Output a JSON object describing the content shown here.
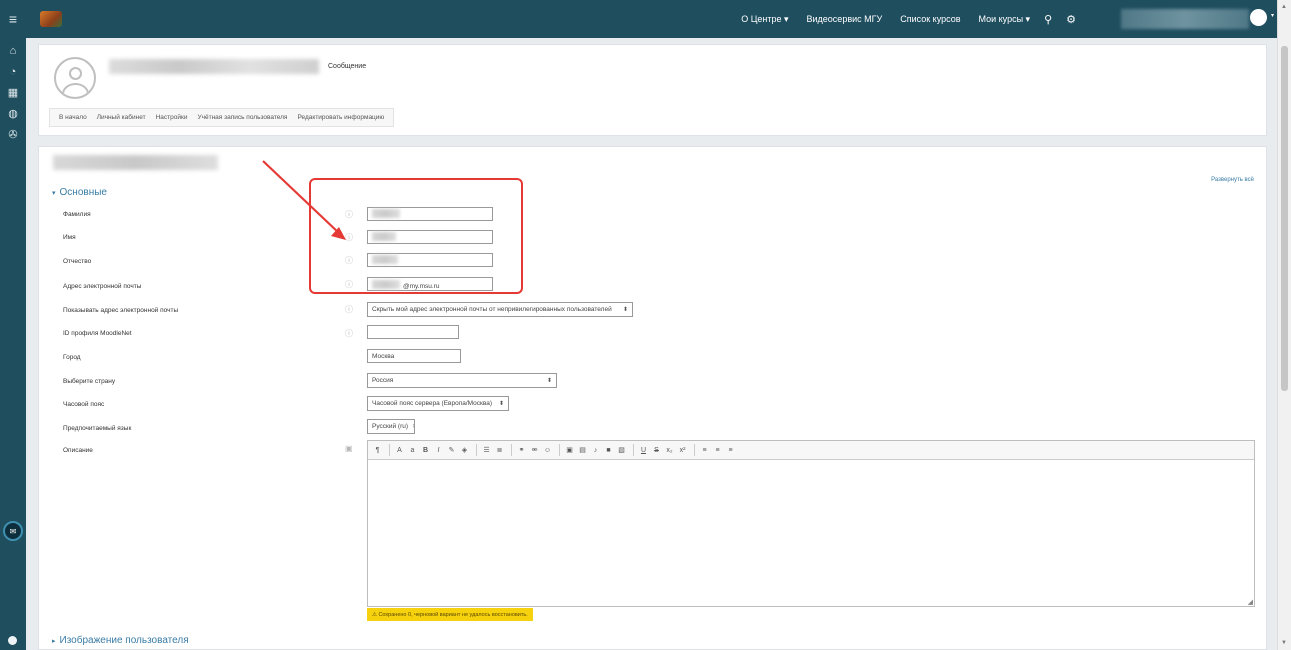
{
  "navbar": {
    "menu_icon": "hamburger-icon",
    "links": [
      "О Центре ▾",
      "Видеосервис МГУ",
      "Список курсов",
      "Мои курсы ▾"
    ],
    "search_icon": "search-icon",
    "settings_icon": "gear-icon"
  },
  "rail": {
    "items": [
      "home-icon",
      "dashboard-icon",
      "calendar-icon",
      "private-files-icon",
      "courses-icon"
    ],
    "chat_icon": "chat-icon"
  },
  "header": {
    "message_link": "Сообщение",
    "secondary_nav": [
      "В начало",
      "Личный кабинет",
      "Настройки",
      "Учётная запись пользователя",
      "Редактировать информацию"
    ]
  },
  "form": {
    "expand_all": "Развернуть всё",
    "section_general": "Основные",
    "section_picture": "Изображение пользователя",
    "labels": {
      "lastname": "Фамилия",
      "firstname": "Имя",
      "middlename": "Отчество",
      "email": "Адрес электронной почты",
      "show_email": "Показывать адрес электронной почты",
      "moodlenet": "ID профиля MoodleNet",
      "city": "Город",
      "country": "Выберите страну",
      "timezone": "Часовой пояс",
      "language": "Предпочитаемый язык",
      "description": "Описание"
    },
    "values": {
      "email_suffix": "@my.msu.ru",
      "show_email": "Скрыть мой адрес электронной почты от непривилегированных пользователей",
      "moodlenet": "",
      "city": "Москва",
      "country": "Россия",
      "timezone": "Часовой пояс сервера (Европа/Москва)",
      "language": "Русский (ru)"
    },
    "autosave_note": "⚠ Сохранено 0, черновой вариант не удалось восстановить."
  },
  "editor": {
    "toolbar_icons": [
      "paragraph-icon",
      "font-icon",
      "size-icon",
      "bold-icon",
      "italic-icon",
      "brush-icon",
      "text-color-icon",
      "bullet-list-icon",
      "numbered-list-icon",
      "link-icon",
      "unlink-icon",
      "emoji-icon",
      "image-icon",
      "media-icon",
      "record-audio-icon",
      "record-video-icon",
      "manage-files-icon",
      "underline-icon",
      "strikethrough-icon",
      "subscript-icon",
      "superscript-icon",
      "align-left-icon",
      "align-center-icon",
      "align-right-icon"
    ]
  },
  "colors": {
    "navbar": "#1f4e5f",
    "accent": "#3a7ca5",
    "annotation": "#e53935",
    "autosave_bg": "#f5d10e"
  }
}
